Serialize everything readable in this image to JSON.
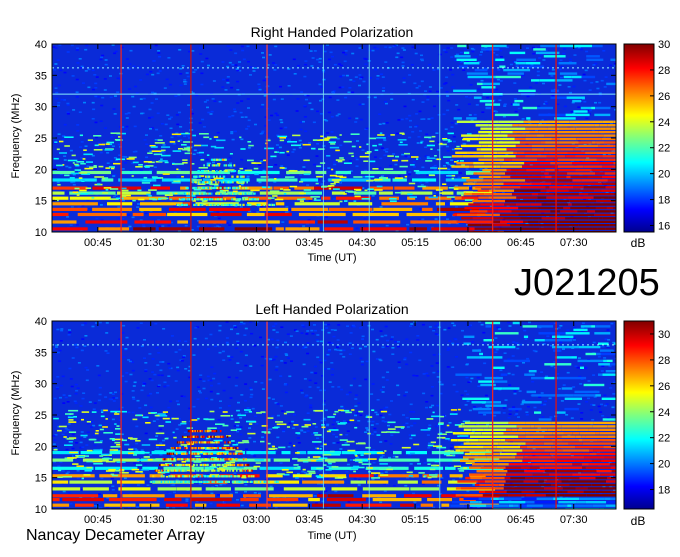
{
  "observation_id": "J021205",
  "footer_label": "Nancay Decameter Array",
  "colorbar_unit": "dB",
  "chart_data": [
    {
      "type": "heatmap",
      "title": "Right Handed Polarization",
      "xlabel": "Time (UT)",
      "ylabel": "Frequency (MHz)",
      "x_tick_labels": [
        "00:45",
        "01:30",
        "02:15",
        "03:00",
        "03:45",
        "04:30",
        "05:15",
        "06:00",
        "06:45",
        "07:30"
      ],
      "x_tick_hours": [
        0.75,
        1.5,
        2.25,
        3.0,
        3.75,
        4.5,
        5.25,
        6.0,
        6.75,
        7.5
      ],
      "xlim_hours": [
        0.1,
        8.1
      ],
      "ylim": [
        10,
        40
      ],
      "y_ticks": [
        10,
        15,
        20,
        25,
        30,
        35,
        40
      ],
      "colorbar": {
        "range": [
          15.5,
          30
        ],
        "ticks": [
          16,
          18,
          20,
          22,
          24,
          26,
          28,
          30
        ],
        "label": "dB",
        "colormap": "jet"
      },
      "features": {
        "interference_lines_hours": [
          1.08,
          2.07,
          3.15,
          6.35,
          7.25
        ],
        "burst": "arc of emission near 02:00–03:00 UT, 15–22 MHz",
        "strong_emission": "broadband high intensity after 06:00 UT, 10–28 MHz"
      }
    },
    {
      "type": "heatmap",
      "title": "Left Handed Polarization",
      "xlabel": "Time (UT)",
      "ylabel": "Frequency (MHz)",
      "x_tick_labels": [
        "00:45",
        "01:30",
        "02:15",
        "03:00",
        "03:45",
        "04:30",
        "05:15",
        "06:00",
        "06:45",
        "07:30"
      ],
      "x_tick_hours": [
        0.75,
        1.5,
        2.25,
        3.0,
        3.75,
        4.5,
        5.25,
        6.0,
        6.75,
        7.5
      ],
      "xlim_hours": [
        0.1,
        8.1
      ],
      "ylim": [
        10,
        40
      ],
      "y_ticks": [
        10,
        15,
        20,
        25,
        30,
        35,
        40
      ],
      "colorbar": {
        "range": [
          16.5,
          31
        ],
        "ticks": [
          18,
          20,
          22,
          24,
          26,
          28,
          30
        ],
        "label": "dB",
        "colormap": "jet"
      },
      "features": {
        "interference_lines_hours": [
          1.08,
          2.07,
          3.15,
          6.35,
          7.25
        ],
        "burst": "strong arc of emission 01:30–03:15 UT, 14–23 MHz",
        "strong_emission": "broadband high intensity after 06:00 UT, 10–22 MHz"
      }
    }
  ]
}
